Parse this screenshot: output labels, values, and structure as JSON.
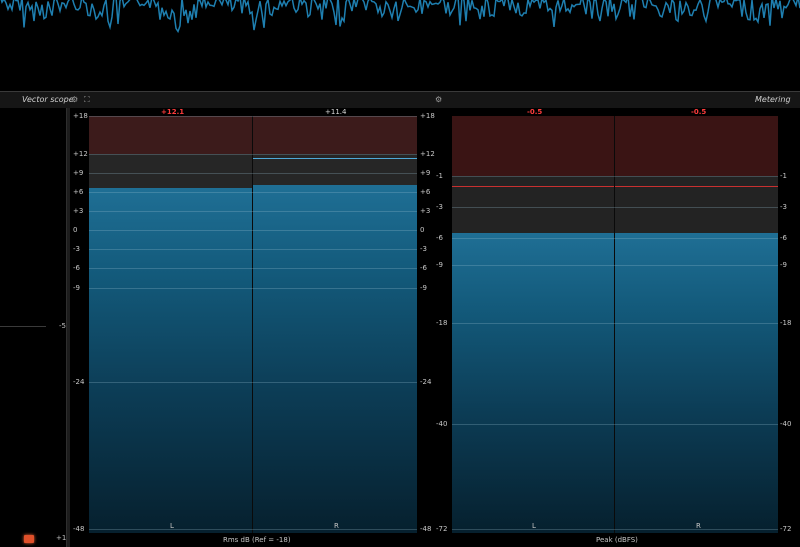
{
  "header": {
    "vector_scope_title": "Vector scope",
    "metering_title": "Metering",
    "settings_icon": "gear-icon",
    "fullscreen_icon": "fullscreen-icon"
  },
  "vector_scope": {
    "mid_label": "-5",
    "bottom_label": "+1"
  },
  "rms_meter": {
    "caption": "Rms dB (Ref = -18)",
    "channels": [
      {
        "label": "L",
        "value": "+12.1",
        "value_color": "#ff3c3c",
        "level_db": 6.6
      },
      {
        "label": "R",
        "value": "+11.4",
        "value_color": "#d8d8d8",
        "level_db": 7.1
      }
    ],
    "scale_left": [
      "+18",
      "+12",
      "+9",
      "+6",
      "+3",
      "0",
      "-3",
      "-6",
      "-9",
      "-24",
      "-48"
    ],
    "scale_right": [
      "+18",
      "+12",
      "+9",
      "+6",
      "+3",
      "0",
      "-3",
      "-6",
      "-9",
      "-24",
      "-48"
    ]
  },
  "peak_meter": {
    "caption": "Peak (dBFS)",
    "channels": [
      {
        "label": "L",
        "value": "-0.5",
        "value_color": "#ff3c3c",
        "level_db": -5.5
      },
      {
        "label": "R",
        "value": "-0.5",
        "value_color": "#ff3c3c",
        "level_db": -5.5
      }
    ],
    "scale_left": [
      "-1",
      "-3",
      "-6",
      "-9",
      "-18",
      "-40",
      "-72"
    ],
    "scale_right": [
      "-1",
      "-3",
      "-6",
      "-9",
      "-18",
      "-40",
      "-72"
    ]
  },
  "colors": {
    "meter_blue": "#1f6f95",
    "red_zone": "#3c1b1b",
    "peak_text": "#ff3c3c",
    "waveform": "#1e7fb0"
  }
}
